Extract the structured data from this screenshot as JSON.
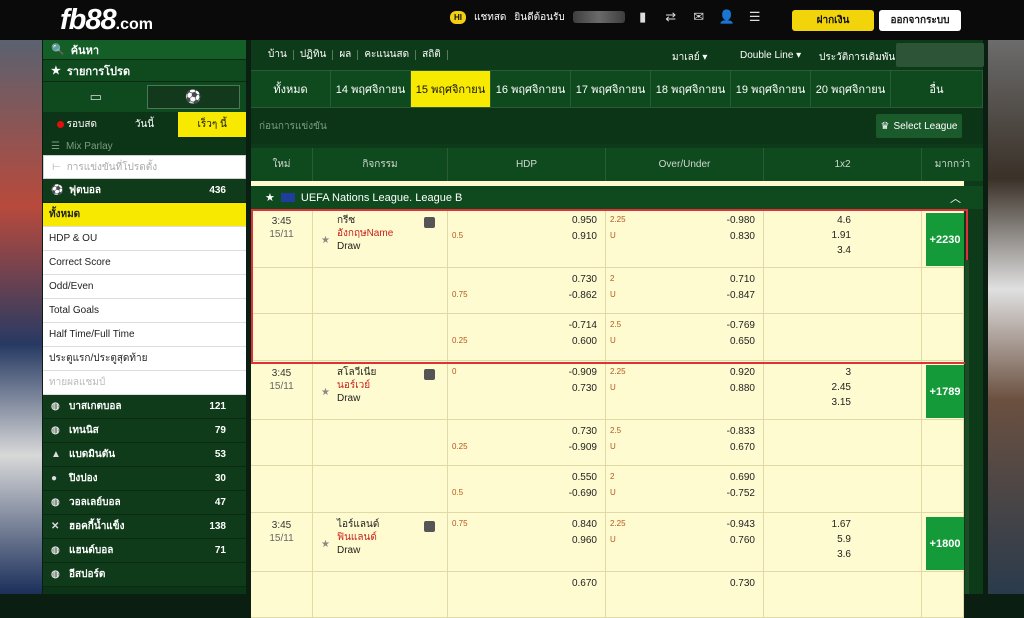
{
  "topbar": {
    "logo": "fb88",
    "logo_suffix": ".com",
    "chat_chip": "HI",
    "chat_label": "แชทสด",
    "welcome": "ยินดีต้อนรับ",
    "deposit": "ฝากเงิน",
    "logout": "ออกจากระบบ"
  },
  "sidebar": {
    "search": "ค้นหา",
    "favorites": "รายการโปรด",
    "tabs": [
      "รอบสด",
      "วันนี้",
      "เร็วๆ นี้"
    ],
    "mix_parlay": "Mix Parlay",
    "fav_matches": "การแข่งขันที่โปรดตั้ง",
    "football": {
      "name": "ฟุตบอล",
      "count": "436"
    },
    "sub_items": [
      "ทั้งหมด",
      "HDP & OU",
      "Correct Score",
      "Odd/Even",
      "Total Goals",
      "Half Time/Full Time",
      "ประตูแรก/ประตูสุดท้าย",
      "ทายผลแชมป์"
    ],
    "sports": [
      {
        "name": "บาสเกตบอล",
        "count": "121"
      },
      {
        "name": "เทนนิส",
        "count": "79"
      },
      {
        "name": "แบดมินตัน",
        "count": "53"
      },
      {
        "name": "ปิงปอง",
        "count": "30"
      },
      {
        "name": "วอลเลย์บอล",
        "count": "47"
      },
      {
        "name": "ฮอคกี้น้ำแข็ง",
        "count": "138"
      },
      {
        "name": "แฮนด์บอล",
        "count": "71"
      },
      {
        "name": "อีสปอร์ต",
        "count": ""
      }
    ]
  },
  "main": {
    "nav": [
      "บ้าน",
      "ปฏิทิน",
      "ผล",
      "คะแนนสด",
      "สถิติ"
    ],
    "odds_type": "มาเลย์",
    "view": "Double Line",
    "history": "ประวัติการเดิมพัน",
    "dates": [
      "ทั้งหมด",
      "14 พฤศจิกายน",
      "15 พฤศจิกายน",
      "16 พฤศจิกายน",
      "17 พฤศจิกายน",
      "18 พฤศจิกายน",
      "19 พฤศจิกายน",
      "20 พฤศจิกายน",
      "อื่น"
    ],
    "section": "ก่อนการแข่งขัน",
    "select_league": "Select League",
    "headers": [
      "ใหม่",
      "กิจกรรม",
      "HDP",
      "Over/Under",
      "1x2",
      "มากกว่า"
    ],
    "league": "UEFA Nations League. League B",
    "matches": [
      {
        "time": "3:45",
        "date": "15/11",
        "home": "กรีซ",
        "away": "อังกฤษName",
        "draw": "Draw",
        "hdp": [
          [
            "",
            "0.950",
            "0.5",
            "0.910"
          ],
          [
            "",
            "0.730",
            "0.75",
            "-0.862"
          ],
          [
            "",
            "-0.714",
            "0.25",
            "0.600"
          ]
        ],
        "ou": [
          [
            "2.25",
            "-0.980",
            "U",
            "0.830"
          ],
          [
            "2",
            "0.710",
            "U",
            "-0.847"
          ],
          [
            "2.5",
            "-0.769",
            "U",
            "0.650"
          ]
        ],
        "x12": [
          "4.6",
          "1.91",
          "3.4"
        ],
        "more": "+2230"
      },
      {
        "time": "3:45",
        "date": "15/11",
        "home": "สโลวีเนีย",
        "away": "นอร์เวย์",
        "draw": "Draw",
        "hdp": [
          [
            "0",
            "-0.909",
            "",
            "0.730"
          ],
          [
            "",
            "0.730",
            "0.25",
            "-0.909"
          ],
          [
            "",
            "0.550",
            "0.5",
            "-0.690"
          ]
        ],
        "ou": [
          [
            "2.25",
            "0.920",
            "U",
            "0.880"
          ],
          [
            "2.5",
            "-0.833",
            "U",
            "0.670"
          ],
          [
            "2",
            "0.690",
            "U",
            "-0.752"
          ]
        ],
        "x12": [
          "3",
          "2.45",
          "3.15"
        ],
        "more": "+1789"
      },
      {
        "time": "3:45",
        "date": "15/11",
        "home": "ไอร์แลนด์",
        "away": "ฟินแลนด์",
        "draw": "Draw",
        "hdp": [
          [
            "0.75",
            "0.840",
            "",
            "0.960"
          ],
          [
            "",
            "0.670",
            "",
            ""
          ]
        ],
        "ou": [
          [
            "2.25",
            "-0.943",
            "U",
            "0.760"
          ],
          [
            "",
            "0.730",
            "",
            ""
          ]
        ],
        "x12": [
          "1.67",
          "5.9",
          "3.6"
        ],
        "more": "+1800"
      }
    ]
  }
}
